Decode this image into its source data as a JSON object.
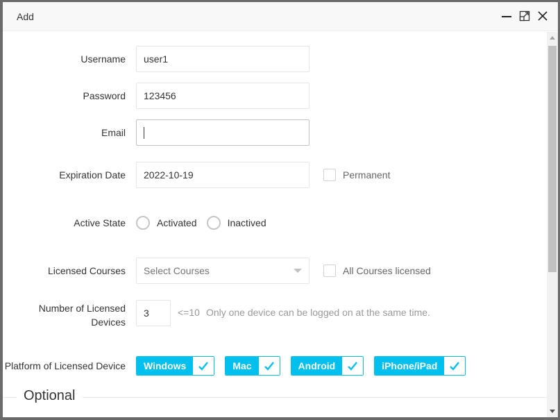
{
  "dialog": {
    "title": "Add",
    "actions": {
      "minimize": "minimize-icon",
      "maximize": "maximize-icon",
      "close": "close-icon"
    }
  },
  "form": {
    "username": {
      "label": "Username",
      "value": "user1"
    },
    "password": {
      "label": "Password",
      "value": "123456"
    },
    "email": {
      "label": "Email",
      "value": ""
    },
    "expiration": {
      "label": "Expiration Date",
      "value": "2022-10-19",
      "permanent_label": "Permanent",
      "permanent_checked": false
    },
    "active_state": {
      "label": "Active State",
      "options": [
        "Activated",
        "Inactived"
      ],
      "selected": null
    },
    "courses": {
      "label": "Licensed Courses",
      "placeholder": "Select Courses",
      "all_label": "All Courses licensed",
      "all_checked": false
    },
    "devices": {
      "label_line1": "Number of Licensed",
      "label_line2": "Devices",
      "value": "3",
      "limit_hint": "<=10",
      "hint": "Only one device can be logged on at the same time."
    },
    "platforms": {
      "label": "Platform of Licensed Device",
      "items": [
        {
          "label": "Windows",
          "checked": true
        },
        {
          "label": "Mac",
          "checked": true
        },
        {
          "label": "Android",
          "checked": true
        },
        {
          "label": "iPhone/iPad",
          "checked": true
        }
      ]
    },
    "optional_section": "Optional"
  },
  "colors": {
    "accent": "#01c0ed",
    "titlebar": "#f8f8f8",
    "overlay": "#6b6b6b"
  }
}
